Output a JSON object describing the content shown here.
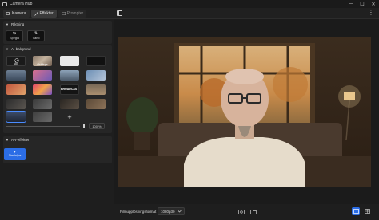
{
  "app": {
    "title": "Camera Hub"
  },
  "window_controls": {
    "minimize": "—",
    "maximize": "☐",
    "close": "✕"
  },
  "tabs": [
    {
      "label": "Kamera",
      "icon": "camera-icon",
      "state": "normal"
    },
    {
      "label": "Effekter",
      "icon": "magic-wand-icon",
      "state": "active"
    },
    {
      "label": "Prompter",
      "icon": "prompter-icon",
      "state": "disabled"
    }
  ],
  "sections": {
    "alignment": {
      "title": "Riktning",
      "buttons": [
        {
          "label": "Spegla",
          "icon_text": "⇆"
        },
        {
          "label": "Vänd",
          "icon_text": "⇅"
        }
      ]
    },
    "ai_background": {
      "title": "AI-bakgrund",
      "tiles": [
        {
          "label": "Av",
          "kind": "none"
        },
        {
          "label": "Oskärpa",
          "kind": "blur"
        },
        {
          "label": "",
          "kind": "white"
        },
        {
          "label": "",
          "kind": "black"
        },
        {
          "label": "",
          "kind": "room"
        },
        {
          "label": "",
          "kind": "studio"
        },
        {
          "label": "",
          "kind": "office"
        },
        {
          "label": "",
          "kind": "space"
        },
        {
          "label": "",
          "kind": "warm"
        },
        {
          "label": "",
          "kind": "colorful"
        },
        {
          "label": "BROADCAST",
          "kind": "broadcast"
        },
        {
          "label": "",
          "kind": "lounge"
        },
        {
          "label": "",
          "kind": "dark1"
        },
        {
          "label": "",
          "kind": "dark2"
        },
        {
          "label": "",
          "kind": "dark3"
        },
        {
          "label": "",
          "kind": "wood"
        },
        {
          "label": "",
          "kind": "selected-room"
        },
        {
          "label": "",
          "kind": "gray"
        }
      ],
      "add_label": "+",
      "zoom": "100 %"
    },
    "ar_effects": {
      "title": "AR-effekter",
      "studio_button": {
        "icon_text": "✦",
        "label": "Studioljus"
      }
    }
  },
  "bottom": {
    "format_label": "Filmupplösningsformat",
    "format_value": "1080p30",
    "dropdown_icon": "chevron-down-icon"
  }
}
